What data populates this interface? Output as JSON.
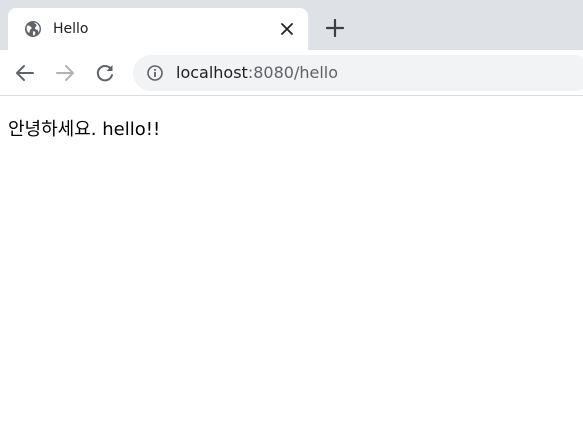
{
  "browser": {
    "tab": {
      "title": "Hello",
      "favicon_icon": "globe-icon",
      "close_icon": "close-icon"
    },
    "new_tab_icon": "plus-icon",
    "nav": {
      "back_icon": "arrow-left-icon",
      "forward_icon": "arrow-right-icon",
      "reload_icon": "reload-icon"
    },
    "address_bar": {
      "site_info_icon": "info-icon",
      "host": "localhost",
      "rest": ":8080/hello"
    }
  },
  "page": {
    "text": "안녕하세요. hello!!"
  },
  "colors": {
    "tabstrip": "#dee1e6",
    "omnibox": "#f1f3f4",
    "icon": "#5f6368",
    "icon_disabled": "#b0b3b8"
  }
}
